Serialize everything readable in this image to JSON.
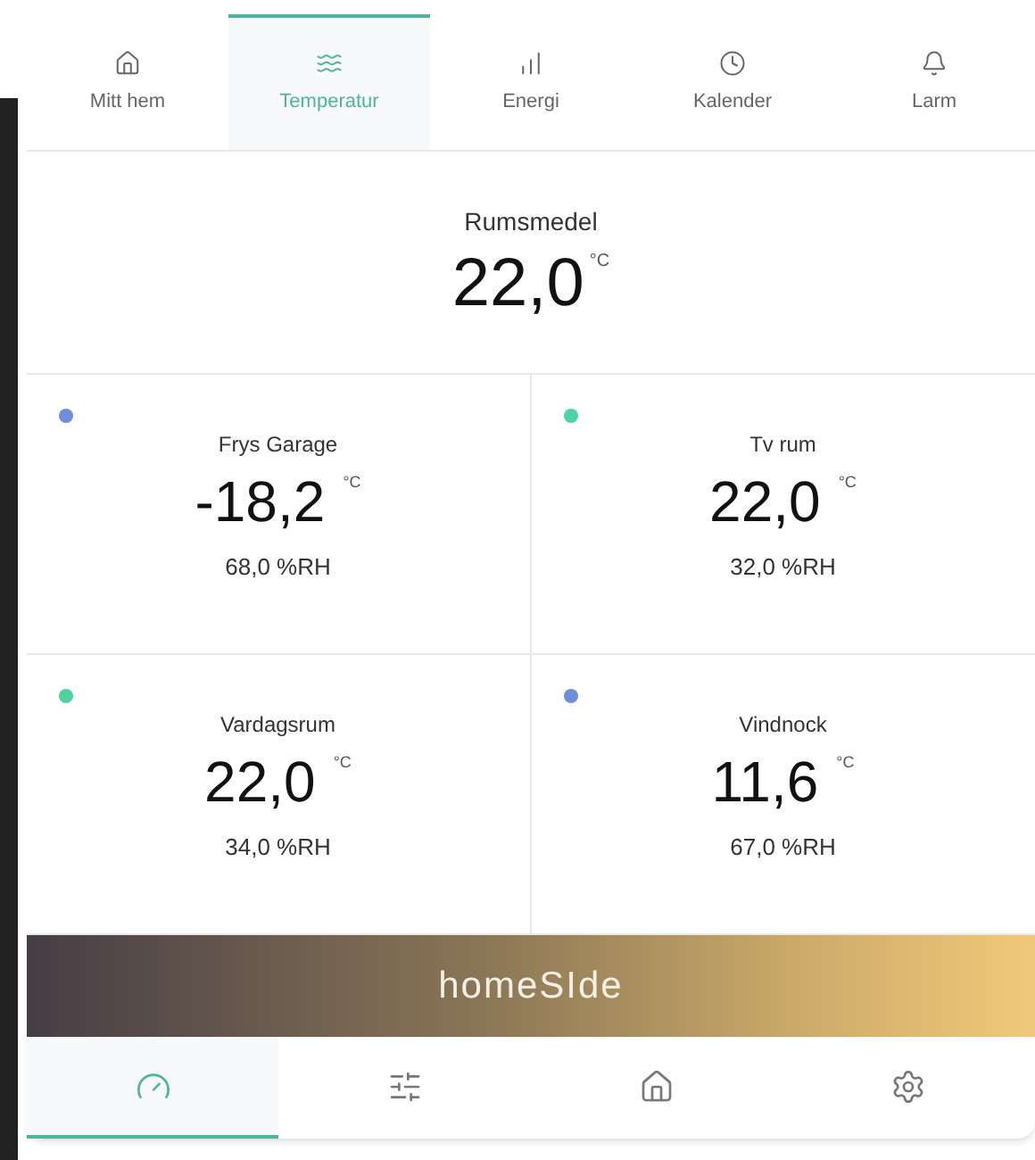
{
  "top_tabs": [
    {
      "label": "Mitt hem",
      "selected": false
    },
    {
      "label": "Temperatur",
      "selected": true
    },
    {
      "label": "Energi",
      "selected": false
    },
    {
      "label": "Kalender",
      "selected": false
    },
    {
      "label": "Larm",
      "selected": false
    }
  ],
  "summary": {
    "label": "Rumsmedel",
    "value": "22,0",
    "unit": "°C"
  },
  "sensors": [
    {
      "name": "Frys Garage",
      "value": "-18,2",
      "unit": "°C",
      "humidity": "68,0 %RH",
      "color": "#6f8ddb"
    },
    {
      "name": "Tv rum",
      "value": "22,0",
      "unit": "°C",
      "humidity": "32,0 %RH",
      "color": "#4fd1a0"
    },
    {
      "name": "Vardagsrum",
      "value": "22,0",
      "unit": "°C",
      "humidity": "34,0 %RH",
      "color": "#4fd1a0"
    },
    {
      "name": "Vindnock",
      "value": "11,6",
      "unit": "°C",
      "humidity": "67,0 %RH",
      "color": "#6f8ddb"
    }
  ],
  "banner": {
    "logo": "homeSIde"
  },
  "bottom_tabs": [
    {
      "selected": true
    },
    {
      "selected": false
    },
    {
      "selected": false
    },
    {
      "selected": false
    }
  ]
}
